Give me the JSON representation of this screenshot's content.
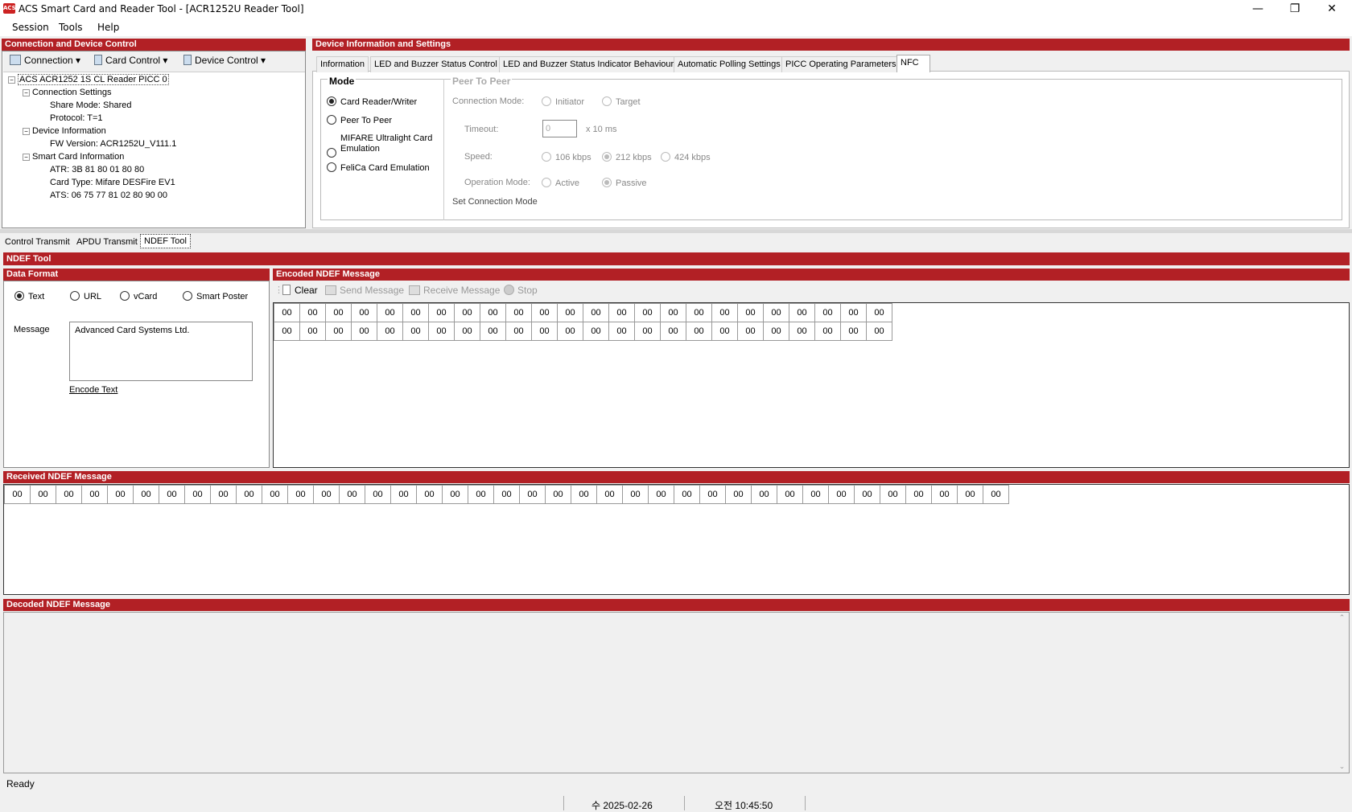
{
  "window": {
    "title": "ACS Smart Card and Reader Tool - [ACR1252U Reader Tool]",
    "icon_text": "ACS"
  },
  "menu": [
    "Session",
    "Tools",
    "Help"
  ],
  "left_panel": {
    "header": "Connection and Device Control",
    "toolbar": [
      "Connection",
      "Card Control",
      "Device Control"
    ],
    "tree": {
      "root": "ACS ACR1252 1S CL Reader PICC 0",
      "connection_settings": "Connection Settings",
      "share_mode": "Share Mode: Shared",
      "protocol": "Protocol: T=1",
      "device_information": "Device Information",
      "fw_version": "FW Version: ACR1252U_V111.1",
      "smart_card_information": "Smart Card Information",
      "atr": "ATR: 3B 81 80 01 80 80",
      "card_type": "Card Type: Mifare DESFire EV1",
      "ats": "ATS: 06 75 77 81 02 80 90 00"
    }
  },
  "right_panel": {
    "header": "Device Information and Settings",
    "tabs": [
      "Information",
      "LED and Buzzer Status Control",
      "LED and Buzzer Status Indicator Behaviour",
      "Automatic Polling Settings",
      "PICC Operating Parameters",
      "NFC"
    ],
    "mode": {
      "title": "Mode",
      "options": [
        "Card Reader/Writer",
        "Peer To Peer",
        "MIFARE Ultralight Card",
        "Emulation",
        "FeliCa Card Emulation"
      ]
    },
    "p2p": {
      "title": "Peer To Peer",
      "connection_mode_label": "Connection Mode:",
      "initiator": "Initiator",
      "target": "Target",
      "timeout_label": "Timeout:",
      "timeout_value": "0",
      "timeout_unit": "x 10 ms",
      "speed_label": "Speed:",
      "speeds": [
        "106 kbps",
        "212 kbps",
        "424 kbps"
      ],
      "operation_mode_label": "Operation Mode:",
      "active": "Active",
      "passive": "Passive",
      "set_connection_mode": "Set Connection Mode"
    }
  },
  "bottom_tabs": [
    "Control Transmit",
    "APDU Transmit",
    "NDEF Tool"
  ],
  "ndef": {
    "header": "NDEF Tool",
    "data_format": {
      "header": "Data Format",
      "options": [
        "Text",
        "URL",
        "vCard",
        "Smart Poster"
      ],
      "message_label": "Message",
      "message_value": "Advanced Card Systems Ltd.",
      "encode_link": "Encode Text"
    },
    "encoded": {
      "header": "Encoded NDEF Message",
      "toolbar": [
        "Clear",
        "Send Message",
        "Receive Message",
        "Stop"
      ],
      "cell": "00"
    },
    "received_header": "Received NDEF Message",
    "received_cell": "00",
    "decoded_header": "Decoded NDEF Message"
  },
  "status": {
    "text": "Ready",
    "date": "수 2025-02-26",
    "time": "오전 10:45:50"
  }
}
